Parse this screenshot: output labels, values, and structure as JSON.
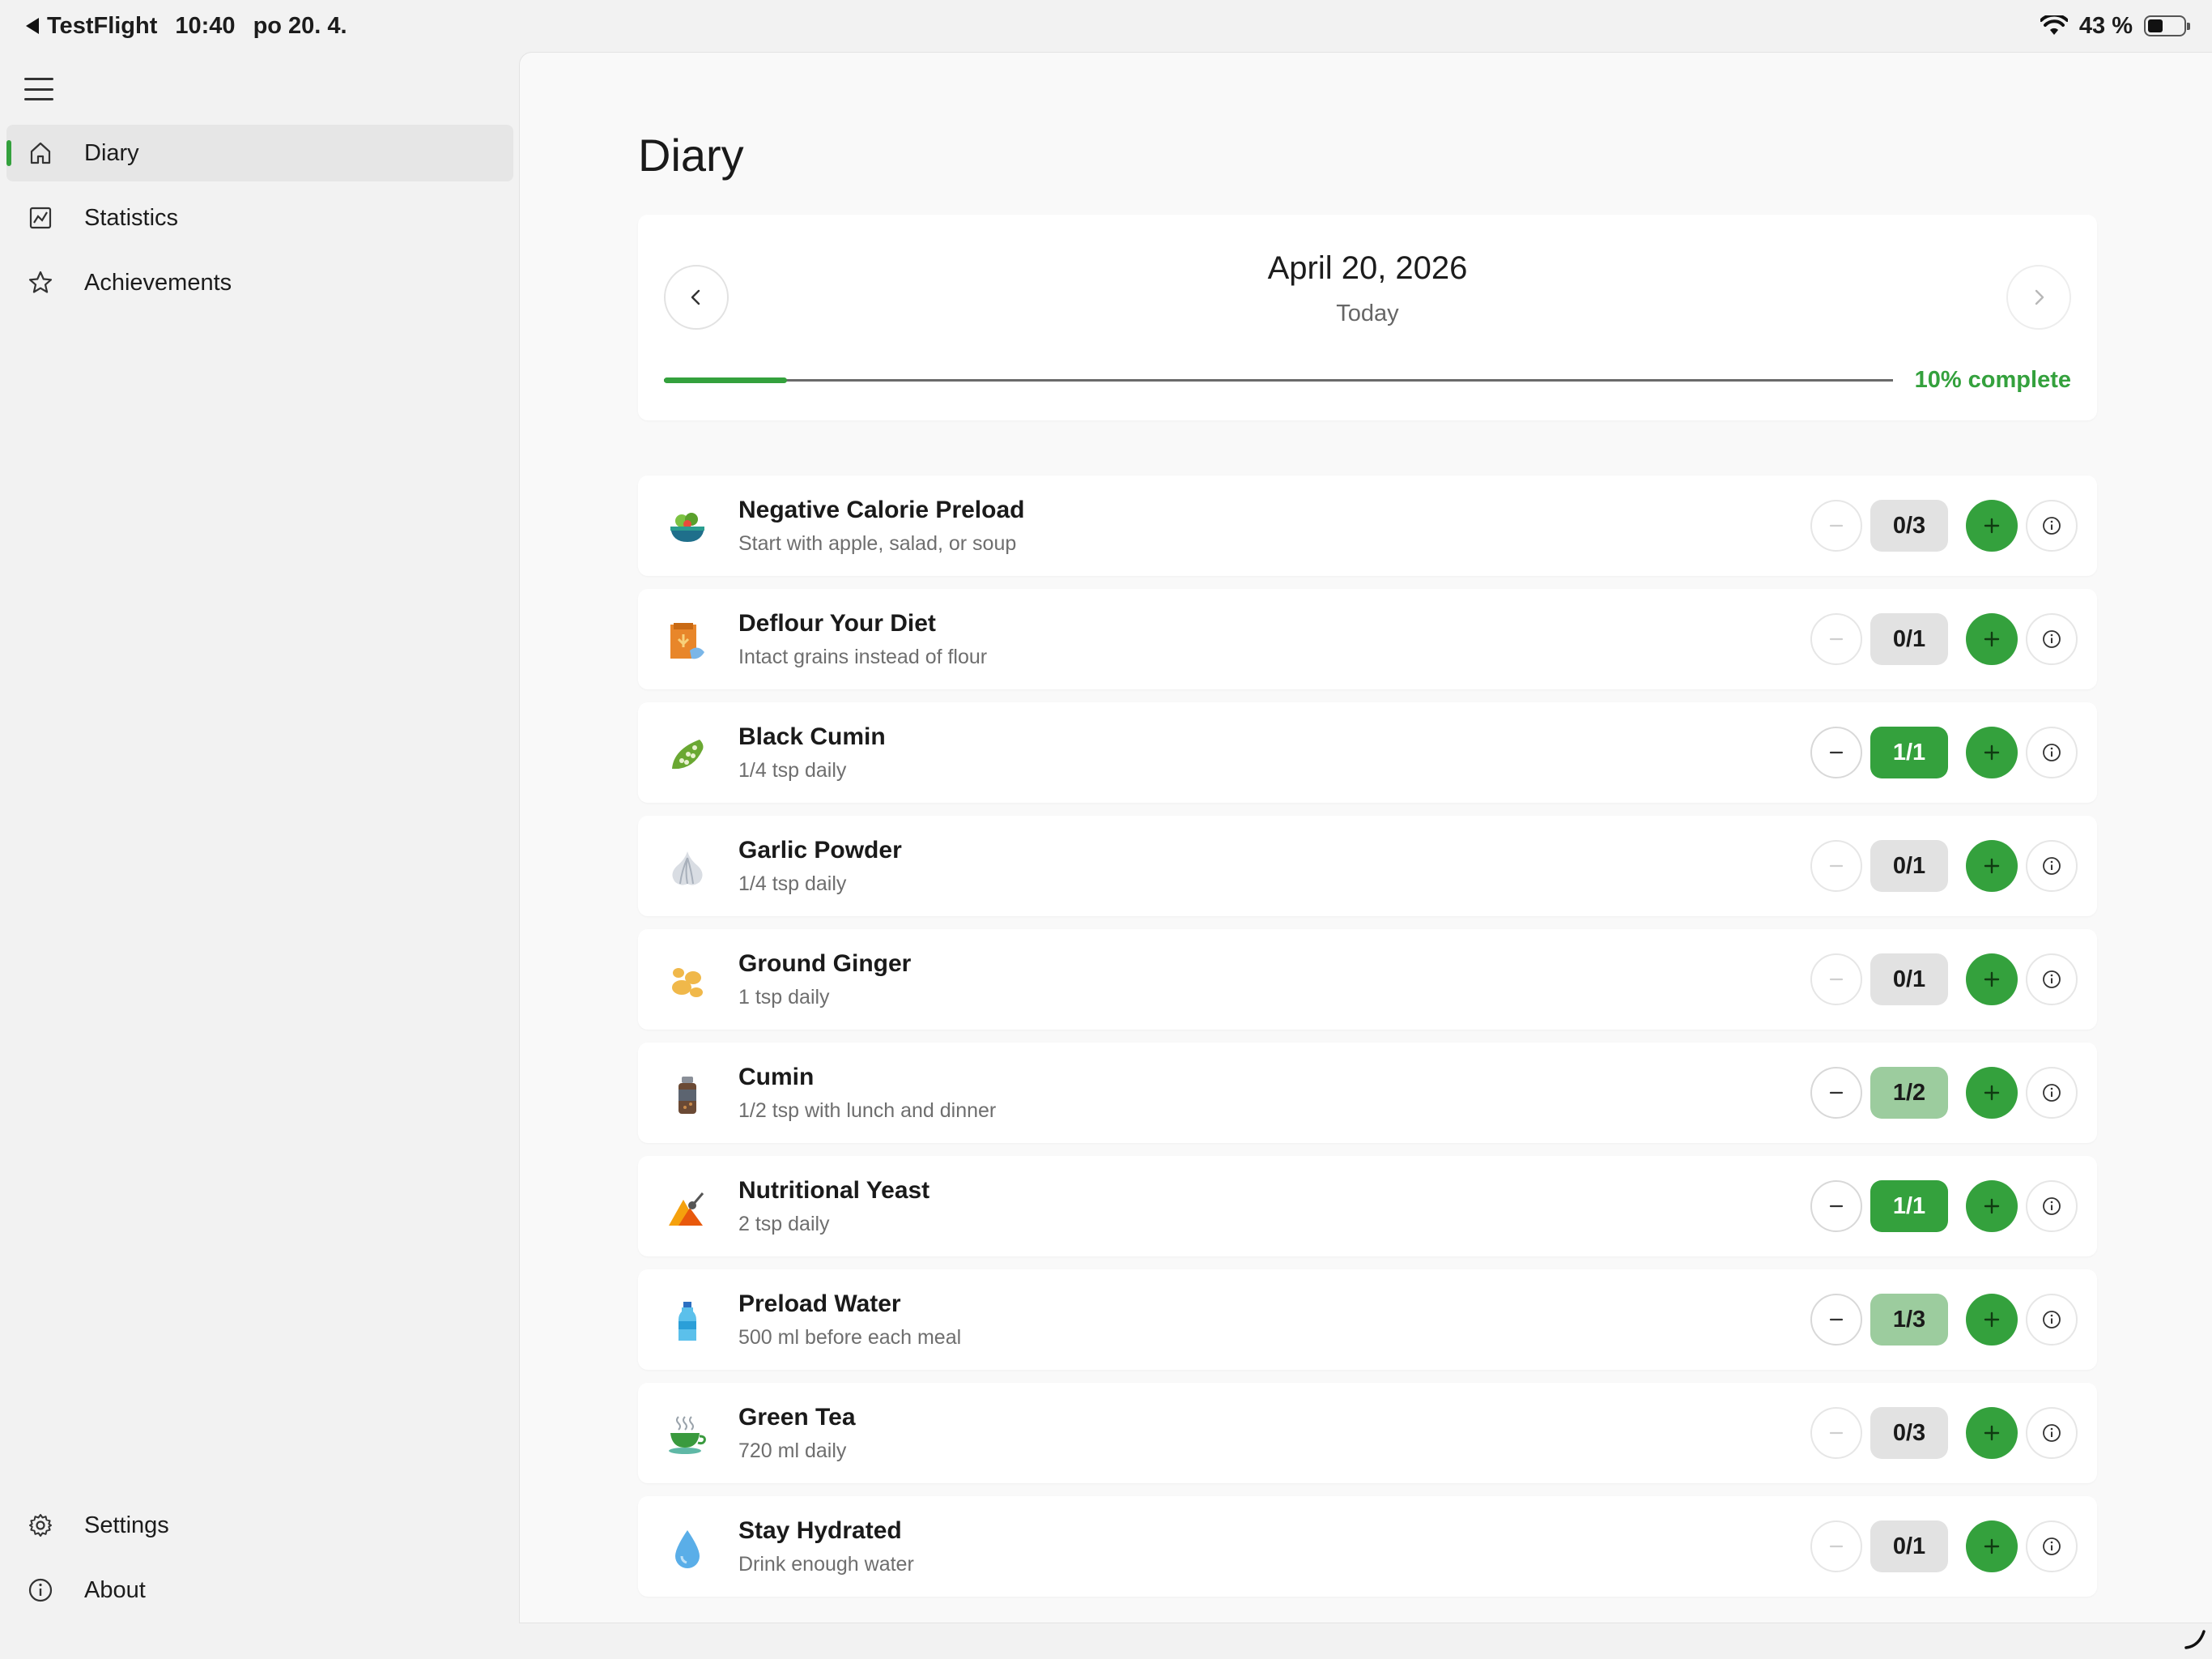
{
  "status_bar": {
    "back_app": "TestFlight",
    "time": "10:40",
    "date": "po 20. 4.",
    "battery": "43 %",
    "battery_level": 0.43
  },
  "sidebar": {
    "items": [
      {
        "label": "Diary",
        "icon": "home-icon",
        "active": true
      },
      {
        "label": "Statistics",
        "icon": "chart-icon",
        "active": false
      },
      {
        "label": "Achievements",
        "icon": "star-icon",
        "active": false
      }
    ],
    "bottom_items": [
      {
        "label": "Settings",
        "icon": "gear-icon"
      },
      {
        "label": "About",
        "icon": "info-icon"
      }
    ]
  },
  "main": {
    "title": "Diary",
    "date_card": {
      "date": "April 20, 2026",
      "relative": "Today",
      "progress": 0.1,
      "progress_label": "10% complete"
    },
    "items": [
      {
        "title": "Negative Calorie Preload",
        "subtitle": "Start with apple, salad, or soup",
        "count": "0/3",
        "done": 0,
        "total": 3,
        "icon": "salad-bowl-icon"
      },
      {
        "title": "Deflour Your Diet",
        "subtitle": "Intact grains instead of flour",
        "count": "0/1",
        "done": 0,
        "total": 1,
        "icon": "grain-bag-icon"
      },
      {
        "title": "Black Cumin",
        "subtitle": "1/4 tsp daily",
        "count": "1/1",
        "done": 1,
        "total": 1,
        "icon": "seed-pod-icon"
      },
      {
        "title": "Garlic Powder",
        "subtitle": "1/4 tsp daily",
        "count": "0/1",
        "done": 0,
        "total": 1,
        "icon": "garlic-icon"
      },
      {
        "title": "Ground Ginger",
        "subtitle": "1 tsp daily",
        "count": "0/1",
        "done": 0,
        "total": 1,
        "icon": "ginger-icon"
      },
      {
        "title": "Cumin",
        "subtitle": "1/2 tsp with lunch and dinner",
        "count": "1/2",
        "done": 1,
        "total": 2,
        "icon": "spice-jar-icon"
      },
      {
        "title": "Nutritional Yeast",
        "subtitle": "2 tsp daily",
        "count": "1/1",
        "done": 1,
        "total": 1,
        "icon": "yeast-flakes-icon"
      },
      {
        "title": "Preload Water",
        "subtitle": "500 ml before each meal",
        "count": "1/3",
        "done": 1,
        "total": 3,
        "icon": "water-bottle-icon"
      },
      {
        "title": "Green Tea",
        "subtitle": "720 ml daily",
        "count": "0/3",
        "done": 0,
        "total": 3,
        "icon": "tea-cup-icon"
      },
      {
        "title": "Stay Hydrated",
        "subtitle": "Drink enough water",
        "count": "0/1",
        "done": 0,
        "total": 1,
        "icon": "water-drop-icon"
      }
    ]
  },
  "colors": {
    "accent": "#34a13d",
    "partial": "#9ccc9e",
    "empty": "#e2e2e2"
  }
}
